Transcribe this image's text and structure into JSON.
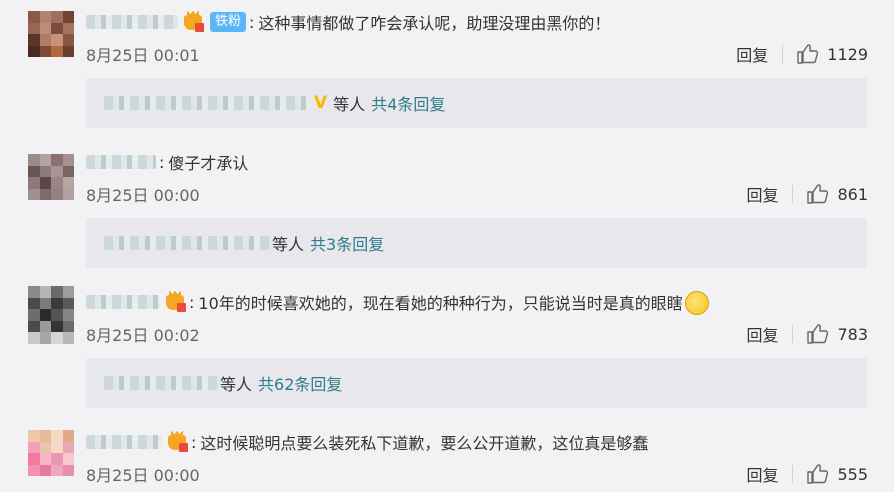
{
  "comments": [
    {
      "fan_badge": "铁粉",
      "text": "这种事情都做了咋会承认呢，助理没理由黑你的！",
      "time": "8月25日 00:01",
      "reply_label": "回复",
      "likes": "1129",
      "replies_suffix": "等人",
      "replies_count": "共4条回复"
    },
    {
      "text": "傻子才承认",
      "time": "8月25日 00:00",
      "reply_label": "回复",
      "likes": "861",
      "replies_suffix": "等人",
      "replies_count": "共3条回复"
    },
    {
      "text": "10年的时候喜欢她的，现在看她的种种行为，只能说当时是真的眼瞎",
      "time": "8月25日 00:02",
      "reply_label": "回复",
      "likes": "783",
      "replies_suffix": "等人",
      "replies_count": "共62条回复"
    },
    {
      "text": "这时候聪明点要么装死私下道歉，要么公开道歉，这位真是够蠢",
      "time": "8月25日 00:00",
      "reply_label": "回复",
      "likes": "555"
    }
  ],
  "icons": {
    "vip": "crown-vip-icon",
    "like": "thumbs-up-icon",
    "emoji": "thinking-face-emoji-icon",
    "verified": "yellow-v-icon"
  },
  "colors": {
    "background": "#f2f2f5",
    "reply_box": "#e8e8ec",
    "link": "#2f7c8b",
    "fan_badge": "#5bb5f7"
  }
}
